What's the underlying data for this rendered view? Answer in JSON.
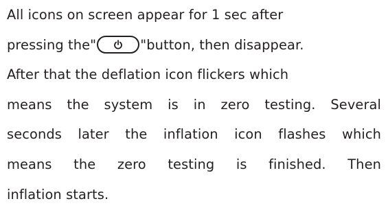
{
  "document": {
    "lines": [
      "All icons on screen appear for 1 sec after",
      {
        "before": "pressing the\"",
        "button_icon": "power-icon",
        "after": "\"button, then disappear."
      },
      "After that the deflation icon flickers which",
      "means the system is in zero testing. Several",
      "seconds later the inflation icon flashes which",
      "means the zero testing is finished. Then",
      "inflation starts."
    ]
  }
}
